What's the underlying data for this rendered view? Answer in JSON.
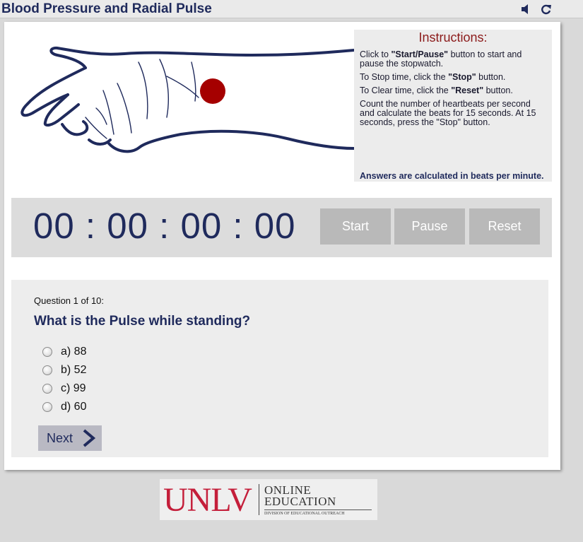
{
  "app": {
    "title": "Blood Pressure and Radial Pulse"
  },
  "toolbar": {
    "sound_icon": "speaker-icon",
    "reload_icon": "reload-icon"
  },
  "instructions": {
    "title": "Instructions:",
    "lines": [
      {
        "pre": "Click to ",
        "bold": "\"Start/Pause\"",
        "post": " button to start and pause the stopwatch."
      },
      {
        "pre": "To Stop time, click the ",
        "bold": "\"Stop\"",
        "post": " button."
      },
      {
        "pre": "To Clear time, click the ",
        "bold": "\"Reset\"",
        "post": " button."
      },
      {
        "pre": "Count the number of heartbeats per second and calculate the beats for 15 seconds. At 15 seconds, press the \"Stop\" button.",
        "bold": "",
        "post": ""
      }
    ],
    "answer_note": "Answers are calculated in beats per minute."
  },
  "stopwatch": {
    "display": "00 : 00 : 00 : 00",
    "start_label": "Start",
    "pause_label": "Pause",
    "reset_label": "Reset"
  },
  "quiz": {
    "question_number": "Question 1 of 10:",
    "question_text": "What is the Pulse while standing?",
    "options": [
      "a) 88",
      "b) 52",
      "c) 99",
      "d) 60"
    ],
    "next_label": "Next"
  },
  "logo": {
    "wordmark": "UNLV",
    "line1": "ONLINE",
    "line2": "EDUCATION",
    "line3": "DIVISION OF EDUCATIONAL OUTREACH"
  },
  "colors": {
    "accent": "#1f2a5c",
    "pulse_dot": "#a50000",
    "brand_red": "#c41e3a",
    "button_gray": "#b9b9b9"
  }
}
